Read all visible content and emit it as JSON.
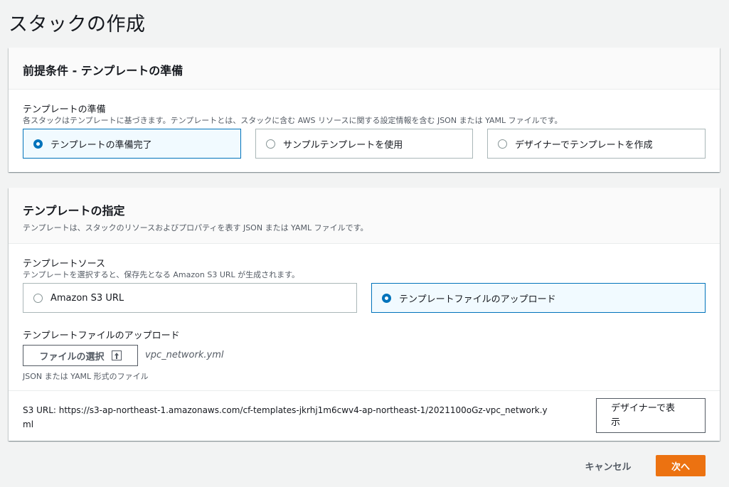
{
  "page": {
    "title": "スタックの作成"
  },
  "prereq": {
    "title": "前提条件 - テンプレートの準備",
    "label": "テンプレートの準備",
    "description": "各スタックはテンプレートに基づきます。テンプレートとは、スタックに含む AWS リソースに関する設定情報を含む JSON または YAML ファイルです。",
    "options": [
      {
        "label": "テンプレートの準備完了",
        "selected": true
      },
      {
        "label": "サンプルテンプレートを使用",
        "selected": false
      },
      {
        "label": "デザイナーでテンプレートを作成",
        "selected": false
      }
    ]
  },
  "specify": {
    "title": "テンプレートの指定",
    "description": "テンプレートは、スタックのリソースおよびプロパティを表す JSON または YAML ファイルです。",
    "source_label": "テンプレートソース",
    "source_desc": "テンプレートを選択すると、保存先となる Amazon S3 URL が生成されます。",
    "sources": [
      {
        "label": "Amazon S3 URL",
        "selected": false
      },
      {
        "label": "テンプレートファイルのアップロード",
        "selected": true
      }
    ],
    "upload_label": "テンプレートファイルのアップロード",
    "choose_file_label": "ファイルの選択",
    "file_name": "vpc_network.yml",
    "file_hint": "JSON または YAML 形式のファイル",
    "s3_url_line1": "S3 URL:   https://s3-ap-northeast-1.amazonaws.com/cf-templates-jkrhj1m6cwv4-ap-northeast-1/2021100oGz-vpc_network.y",
    "s3_url_line2": "ml",
    "designer_button_line1": "デザイナーで表",
    "designer_button_line2": "示"
  },
  "footer": {
    "cancel_label": "キャンセル",
    "next_label": "次へ"
  },
  "colors": {
    "accent": "#0073bb",
    "primary_button": "#ec7211",
    "background": "#f2f3f3"
  }
}
